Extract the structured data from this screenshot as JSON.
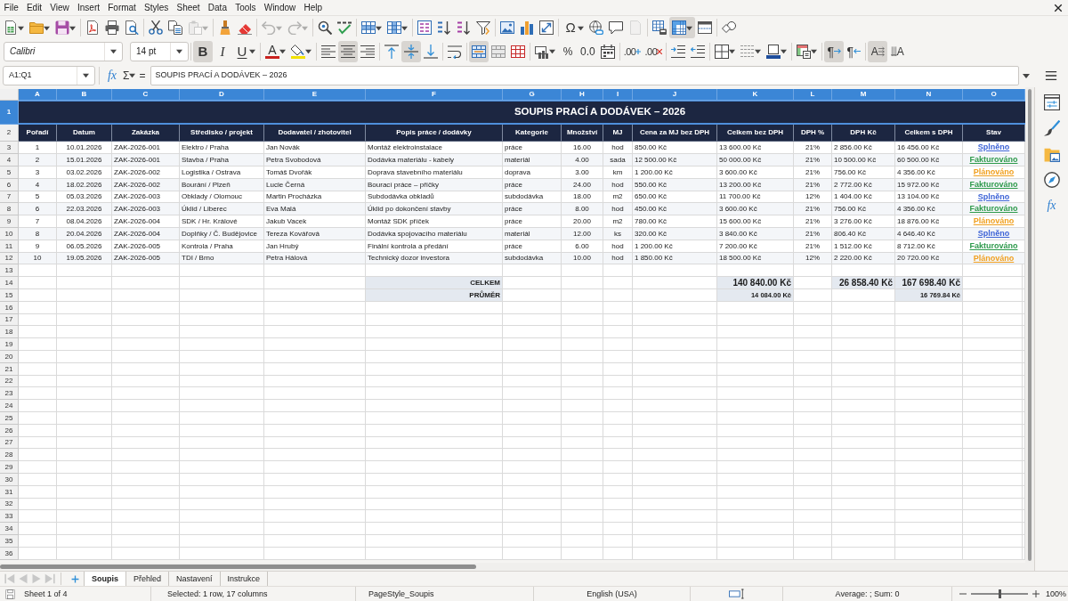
{
  "menu_bar": {
    "items": [
      "File",
      "Edit",
      "View",
      "Insert",
      "Format",
      "Styles",
      "Sheet",
      "Data",
      "Tools",
      "Window",
      "Help"
    ]
  },
  "standard_toolbar": {
    "paste_disabled": true,
    "undo_disabled": true,
    "redo_disabled": true,
    "headers_footers_disabled": true,
    "freeze_panes_pressed": true,
    "special_character": "Ω"
  },
  "formatting_toolbar": {
    "font_name": "Calibri",
    "font_size": "14 pt",
    "bold": {
      "label": "B",
      "pressed": true
    },
    "italic": {
      "label": "I",
      "pressed": false
    },
    "underline": {
      "label": "U",
      "pressed": false
    },
    "font_color": {
      "label": "A"
    },
    "align_left_pressed": false,
    "align_center_pressed": true,
    "align_right_pressed": false,
    "align_top_pressed": false,
    "align_middle_pressed": true,
    "align_bottom_pressed": false,
    "merge_and_center_pressed": true,
    "percent": "%",
    "standard_format": "0.0",
    "add_decimal": ".00",
    "delete_decimal": ".00",
    "left_to_right": {
      "label": "¶",
      "pressed": true
    },
    "right_to_left": {
      "label": "¶",
      "pressed": false
    },
    "text_left_to_right": {
      "label": "A",
      "pressed": true
    },
    "text_top_to_bottom": {
      "label": "A",
      "pressed": false
    }
  },
  "formula_bar": {
    "name_box": "A1:Q1",
    "function_wizard": "fx",
    "sum": "Σ",
    "formula": "=",
    "content": "SOUPIS PRACÍ A DODÁVEK – 2026"
  },
  "sheet": {
    "columns": [
      {
        "label": "A",
        "selected": true
      },
      {
        "label": "B",
        "selected": true
      },
      {
        "label": "C",
        "selected": true
      },
      {
        "label": "D",
        "selected": true
      },
      {
        "label": "E",
        "selected": true
      },
      {
        "label": "F",
        "selected": true
      },
      {
        "label": "G",
        "selected": true
      },
      {
        "label": "H",
        "selected": true
      },
      {
        "label": "I",
        "selected": true
      },
      {
        "label": "J",
        "selected": true
      },
      {
        "label": "K",
        "selected": true
      },
      {
        "label": "L",
        "selected": true
      },
      {
        "label": "M",
        "selected": true
      },
      {
        "label": "N",
        "selected": true
      },
      {
        "label": "O",
        "selected": true
      }
    ],
    "rows": [
      {
        "label": "1",
        "selected": true
      },
      {
        "label": "2",
        "selected": false
      },
      {
        "label": "3",
        "selected": false
      },
      {
        "label": "4",
        "selected": false
      },
      {
        "label": "5",
        "selected": false
      },
      {
        "label": "6",
        "selected": false
      },
      {
        "label": "7",
        "selected": false
      },
      {
        "label": "8",
        "selected": false
      },
      {
        "label": "9",
        "selected": false
      },
      {
        "label": "10",
        "selected": false
      },
      {
        "label": "11",
        "selected": false
      },
      {
        "label": "12",
        "selected": false
      },
      {
        "label": "13",
        "selected": false
      },
      {
        "label": "14",
        "selected": false
      },
      {
        "label": "15",
        "selected": false
      },
      {
        "label": "16",
        "selected": false
      },
      {
        "label": "17",
        "selected": false
      },
      {
        "label": "18",
        "selected": false
      },
      {
        "label": "19",
        "selected": false
      },
      {
        "label": "20",
        "selected": false
      },
      {
        "label": "21",
        "selected": false
      },
      {
        "label": "22",
        "selected": false
      },
      {
        "label": "23",
        "selected": false
      },
      {
        "label": "24",
        "selected": false
      },
      {
        "label": "25",
        "selected": false
      },
      {
        "label": "26",
        "selected": false
      },
      {
        "label": "27",
        "selected": false
      },
      {
        "label": "28",
        "selected": false
      },
      {
        "label": "29",
        "selected": false
      },
      {
        "label": "30",
        "selected": false
      },
      {
        "label": "31",
        "selected": false
      },
      {
        "label": "32",
        "selected": false
      },
      {
        "label": "33",
        "selected": false
      },
      {
        "label": "34",
        "selected": false
      },
      {
        "label": "35",
        "selected": false
      },
      {
        "label": "36",
        "selected": false
      }
    ],
    "title": "SOUPIS PRACÍ A DODÁVEK – 2026",
    "headers": [
      "Pořadí",
      "Datum",
      "Zakázka",
      "Středisko / projekt",
      "Dodavatel / zhotovitel",
      "Popis práce / dodávky",
      "Kategorie",
      "Množství",
      "MJ",
      "Cena za MJ bez DPH",
      "Celkem bez DPH",
      "DPH %",
      "DPH Kč",
      "Celkem s DPH",
      "Stav"
    ],
    "records": [
      {
        "cells": [
          "1",
          "10.01.2026",
          "ZAK-2026-001",
          "Elektro / Praha",
          "Jan Novák",
          "Montáž elektroinstalace",
          "práce",
          "16.00",
          "hod",
          "850.00 Kč",
          "13 600.00 Kč",
          "21%",
          "2 856.00 Kč",
          "16 456.00 Kč"
        ],
        "status": {
          "text": "Splněno",
          "color": "#3d63d6"
        }
      },
      {
        "cells": [
          "2",
          "15.01.2026",
          "ZAK-2026-001",
          "Stavba / Praha",
          "Petra Svobodová",
          "Dodávka materiálu - kabely",
          "materiál",
          "4.00",
          "sada",
          "12 500.00 Kč",
          "50 000.00 Kč",
          "21%",
          "10 500.00 Kč",
          "60 500.00 Kč"
        ],
        "status": {
          "text": "Fakturováno",
          "color": "#2e9a4c"
        }
      },
      {
        "cells": [
          "3",
          "03.02.2026",
          "ZAK-2026-002",
          "Logistika / Ostrava",
          "Tomáš Dvořák",
          "Doprava stavebního materiálu",
          "doprava",
          "3.00",
          "km",
          "1 200.00 Kč",
          "3 600.00 Kč",
          "21%",
          "756.00 Kč",
          "4 356.00 Kč"
        ],
        "status": {
          "text": "Plánováno",
          "color": "#f0a020"
        }
      },
      {
        "cells": [
          "4",
          "18.02.2026",
          "ZAK-2026-002",
          "Bourání / Plzeň",
          "Lucie Černá",
          "Bourací práce – příčky",
          "práce",
          "24.00",
          "hod",
          "550.00 Kč",
          "13 200.00 Kč",
          "21%",
          "2 772.00 Kč",
          "15 972.00 Kč"
        ],
        "status": {
          "text": "Fakturováno",
          "color": "#2e9a4c"
        }
      },
      {
        "cells": [
          "5",
          "05.03.2026",
          "ZAK-2026-003",
          "Obklady / Olomouc",
          "Martin Procházka",
          "Subdodávka obkladů",
          "subdodávka",
          "18.00",
          "m2",
          "650.00 Kč",
          "11 700.00 Kč",
          "12%",
          "1 404.00 Kč",
          "13 104.00 Kč"
        ],
        "status": {
          "text": "Splněno",
          "color": "#3d63d6"
        }
      },
      {
        "cells": [
          "6",
          "22.03.2026",
          "ZAK-2026-003",
          "Úklid / Liberec",
          "Eva Malá",
          "Úklid po dokončení stavby",
          "práce",
          "8.00",
          "hod",
          "450.00 Kč",
          "3 600.00 Kč",
          "21%",
          "756.00 Kč",
          "4 356.00 Kč"
        ],
        "status": {
          "text": "Fakturováno",
          "color": "#2e9a4c"
        }
      },
      {
        "cells": [
          "7",
          "08.04.2026",
          "ZAK-2026-004",
          "SDK / Hr. Králové",
          "Jakub Vacek",
          "Montáž SDK příček",
          "práce",
          "20.00",
          "m2",
          "780.00 Kč",
          "15 600.00 Kč",
          "21%",
          "3 276.00 Kč",
          "18 876.00 Kč"
        ],
        "status": {
          "text": "Plánováno",
          "color": "#f0a020"
        }
      },
      {
        "cells": [
          "8",
          "20.04.2026",
          "ZAK-2026-004",
          "Doplňky / Č. Budějovice",
          "Tereza Kovářová",
          "Dodávka spojovacího materiálu",
          "materiál",
          "12.00",
          "ks",
          "320.00 Kč",
          "3 840.00 Kč",
          "21%",
          "806.40 Kč",
          "4 646.40 Kč"
        ],
        "status": {
          "text": "Splněno",
          "color": "#3d63d6"
        }
      },
      {
        "cells": [
          "9",
          "06.05.2026",
          "ZAK-2026-005",
          "Kontrola / Praha",
          "Jan Hrubý",
          "Finální kontrola a předání",
          "práce",
          "6.00",
          "hod",
          "1 200.00 Kč",
          "7 200.00 Kč",
          "21%",
          "1 512.00 Kč",
          "8 712.00 Kč"
        ],
        "status": {
          "text": "Fakturováno",
          "color": "#2e9a4c"
        }
      },
      {
        "cells": [
          "10",
          "19.05.2026",
          "ZAK-2026-005",
          "TDI / Brno",
          "Petra Hálová",
          "Technický dozor investora",
          "subdodávka",
          "10.00",
          "hod",
          "1 850.00 Kč",
          "18 500.00 Kč",
          "12%",
          "2 220.00 Kč",
          "20 720.00 Kč"
        ],
        "status": {
          "text": "Plánováno",
          "color": "#f0a020"
        }
      }
    ],
    "summary": [
      {
        "kind": "total",
        "label": "CELKEM",
        "total_without_vat": "140 840.00 Kč",
        "vat": "26 858.40 Kč",
        "total_with_vat": "167 698.40 Kč"
      },
      {
        "kind": "average",
        "label": "PRŮMĚR",
        "total_without_vat": "14 084.00 Kč",
        "total_with_vat": "16 769.84 Kč"
      }
    ]
  },
  "sidebar": {
    "functions_label": "fx"
  },
  "sheet_tabs": [
    {
      "label": "Soupis",
      "selected": true
    },
    {
      "label": "Přehled",
      "selected": false
    },
    {
      "label": "Nastavení",
      "selected": false
    },
    {
      "label": "Instrukce",
      "selected": false
    }
  ],
  "status_bar": {
    "sheet": "Sheet 1 of 4",
    "selection": "Selected: 1 row, 17 columns",
    "page_style": "PageStyle_Soupis",
    "language": "English (USA)",
    "summary": "Average: ; Sum: 0",
    "zoom": {
      "level": 0.5,
      "reading": "100%"
    }
  }
}
